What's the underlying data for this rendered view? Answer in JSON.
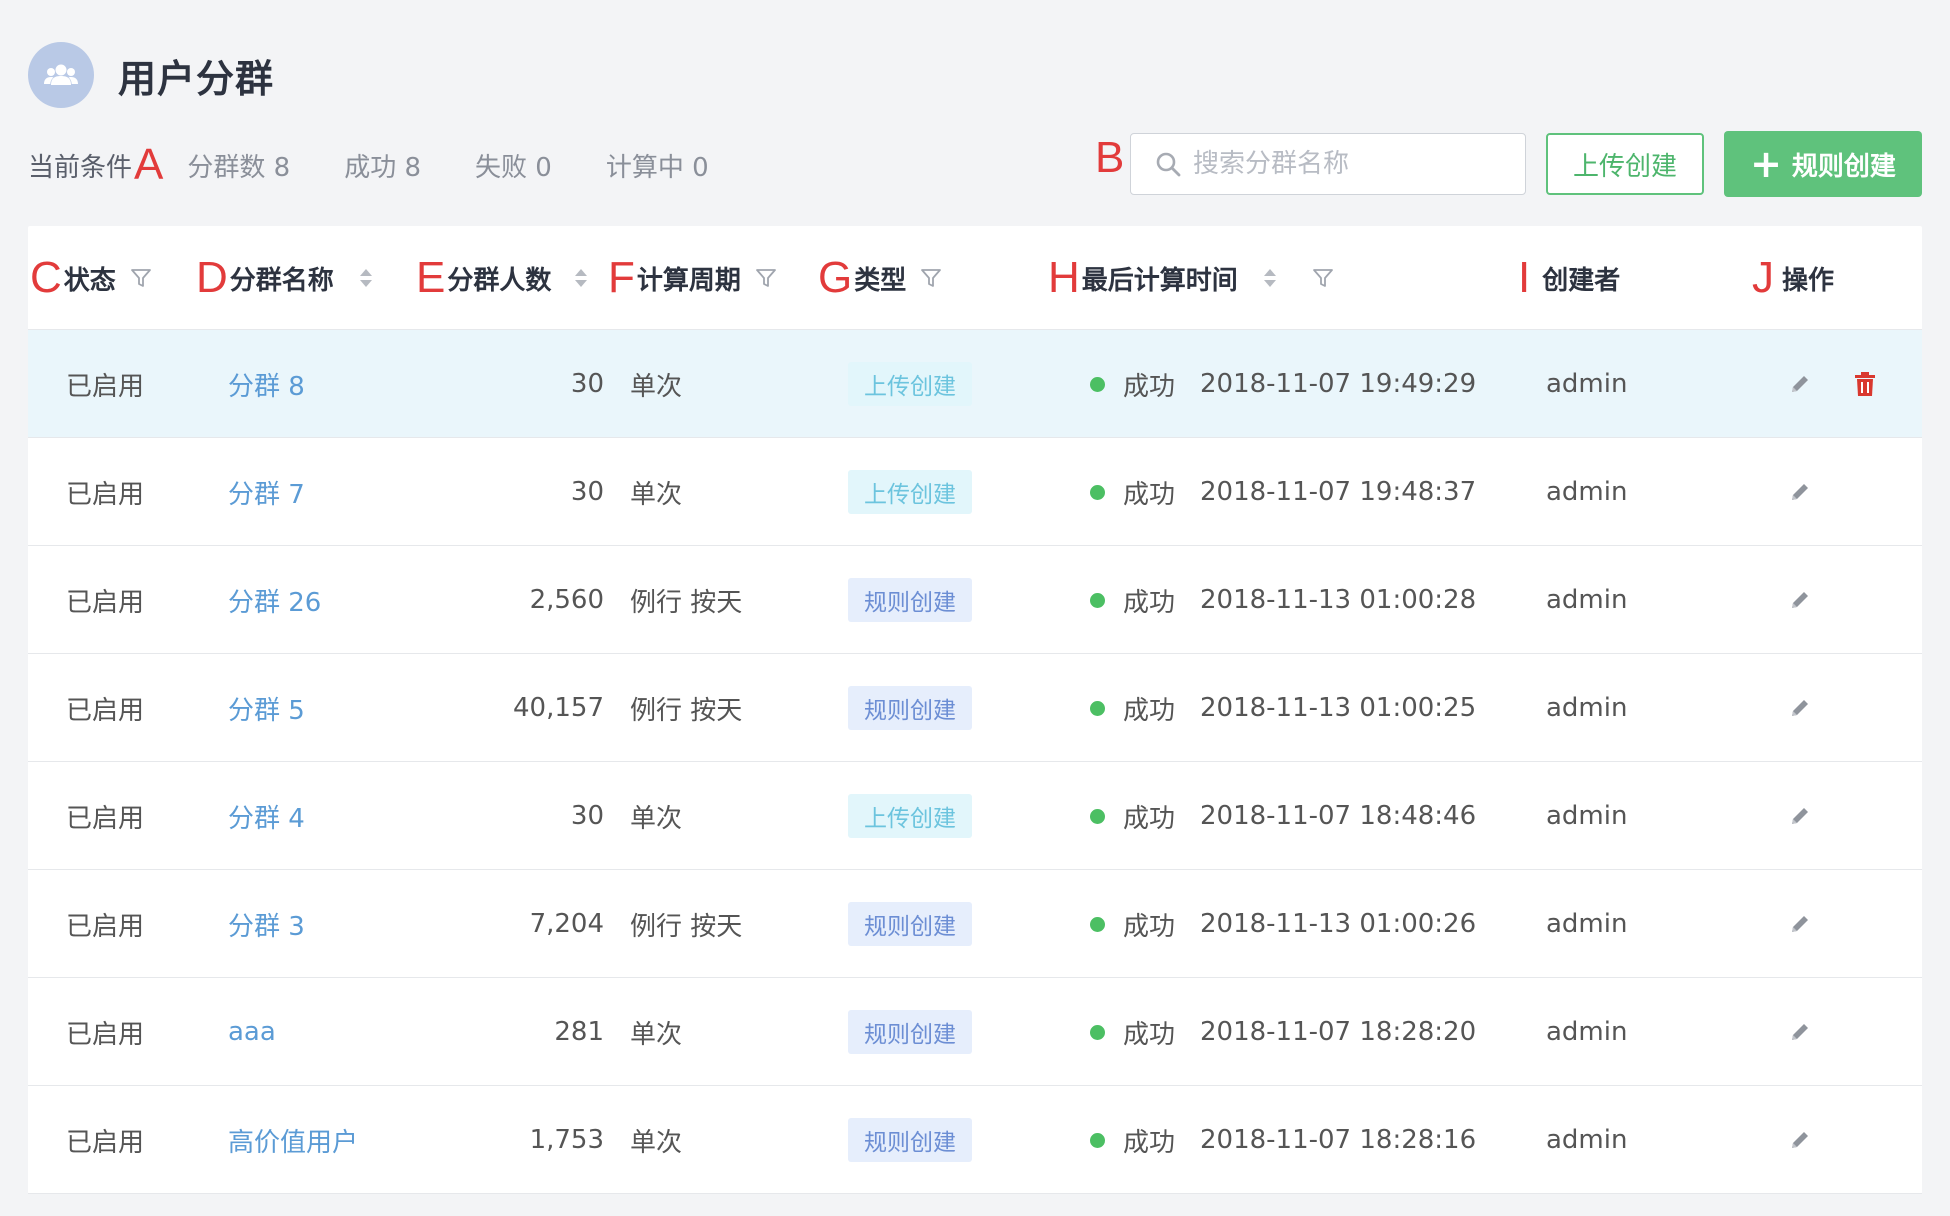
{
  "header": {
    "title": "用户分群"
  },
  "conditions": {
    "label": "当前条件",
    "marker": "A",
    "stats": [
      "分群数 8",
      "成功 8",
      "失败 0",
      "计算中 0"
    ]
  },
  "search": {
    "marker": "B",
    "placeholder": "搜索分群名称"
  },
  "buttons": {
    "upload_label": "上传创建",
    "rule_label": "规则创建",
    "rule_plus": "+"
  },
  "columns": [
    {
      "marker": "C",
      "label": "状态",
      "icon": "filter"
    },
    {
      "marker": "D",
      "label": "分群名称",
      "icon": "sort"
    },
    {
      "marker": "E",
      "label": "分群人数",
      "icon": "sort"
    },
    {
      "marker": "F",
      "label": "计算周期",
      "icon": "filter"
    },
    {
      "marker": "G",
      "label": "类型",
      "icon": "filter"
    },
    {
      "marker": "H",
      "label": "最后计算时间",
      "icon": "sort-filter"
    },
    {
      "marker": "I",
      "label": "创建者",
      "icon": ""
    },
    {
      "marker": "J",
      "label": "操作",
      "icon": ""
    }
  ],
  "rows": [
    {
      "status": "已启用",
      "name": "分群 8",
      "count": "30",
      "period": "单次",
      "type": "上传创建",
      "type_kind": "upload",
      "result": "成功",
      "time": "2018-11-07 19:49:29",
      "creator": "admin",
      "deletable": true
    },
    {
      "status": "已启用",
      "name": "分群 7",
      "count": "30",
      "period": "单次",
      "type": "上传创建",
      "type_kind": "upload",
      "result": "成功",
      "time": "2018-11-07 19:48:37",
      "creator": "admin",
      "deletable": false
    },
    {
      "status": "已启用",
      "name": "分群 26",
      "count": "2,560",
      "period": "例行 按天",
      "type": "规则创建",
      "type_kind": "rule",
      "result": "成功",
      "time": "2018-11-13 01:00:28",
      "creator": "admin",
      "deletable": false
    },
    {
      "status": "已启用",
      "name": "分群 5",
      "count": "40,157",
      "period": "例行 按天",
      "type": "规则创建",
      "type_kind": "rule",
      "result": "成功",
      "time": "2018-11-13 01:00:25",
      "creator": "admin",
      "deletable": false
    },
    {
      "status": "已启用",
      "name": "分群 4",
      "count": "30",
      "period": "单次",
      "type": "上传创建",
      "type_kind": "upload",
      "result": "成功",
      "time": "2018-11-07 18:48:46",
      "creator": "admin",
      "deletable": false
    },
    {
      "status": "已启用",
      "name": "分群 3",
      "count": "7,204",
      "period": "例行 按天",
      "type": "规则创建",
      "type_kind": "rule",
      "result": "成功",
      "time": "2018-11-13 01:00:26",
      "creator": "admin",
      "deletable": false
    },
    {
      "status": "已启用",
      "name": "aaa",
      "count": "281",
      "period": "单次",
      "type": "规则创建",
      "type_kind": "rule",
      "result": "成功",
      "time": "2018-11-07 18:28:20",
      "creator": "admin",
      "deletable": false
    },
    {
      "status": "已启用",
      "name": "高价值用户",
      "count": "1,753",
      "period": "单次",
      "type": "规则创建",
      "type_kind": "rule",
      "result": "成功",
      "time": "2018-11-07 18:28:16",
      "creator": "admin",
      "deletable": false
    }
  ],
  "icons": {
    "avatar": "user-group-icon",
    "search": "search-icon",
    "filter": "filter-icon",
    "sort": "sort-icon",
    "edit": "pencil-icon",
    "delete": "trash-icon"
  },
  "colors": {
    "accent_green": "#5fc27c",
    "link_blue": "#5b9bd5",
    "marker_red": "#e23b3b",
    "success_dot": "#4cbf63",
    "delete_red": "#d9382f",
    "highlight_row": "#eaf6fb"
  }
}
